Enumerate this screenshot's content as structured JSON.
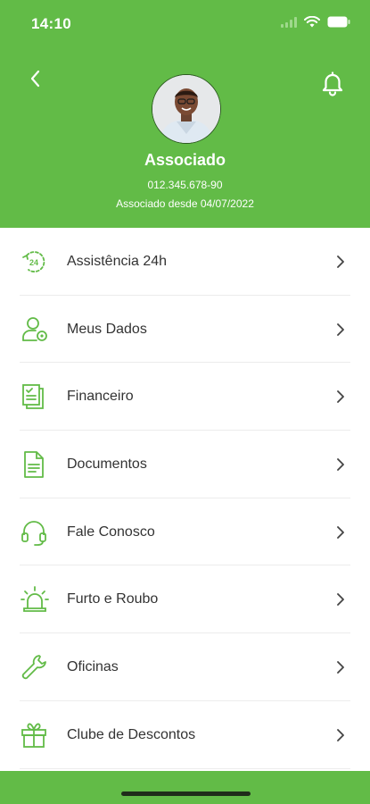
{
  "status": {
    "time": "14:10"
  },
  "profile": {
    "name": "Associado",
    "document": "012.345.678-90",
    "member_since": "Associado desde 04/07/2022"
  },
  "menu": [
    {
      "label": "Assistência 24h",
      "icon": "clock-24h-icon"
    },
    {
      "label": "Meus Dados",
      "icon": "user-settings-icon"
    },
    {
      "label": "Financeiro",
      "icon": "invoice-icon"
    },
    {
      "label": "Documentos",
      "icon": "document-icon"
    },
    {
      "label": "Fale Conosco",
      "icon": "headset-icon"
    },
    {
      "label": "Furto e Roubo",
      "icon": "alarm-siren-icon"
    },
    {
      "label": "Oficinas",
      "icon": "wrench-icon"
    },
    {
      "label": "Clube de Descontos",
      "icon": "gift-icon"
    }
  ],
  "colors": {
    "brand": "#62bb47",
    "text": "#333333"
  }
}
